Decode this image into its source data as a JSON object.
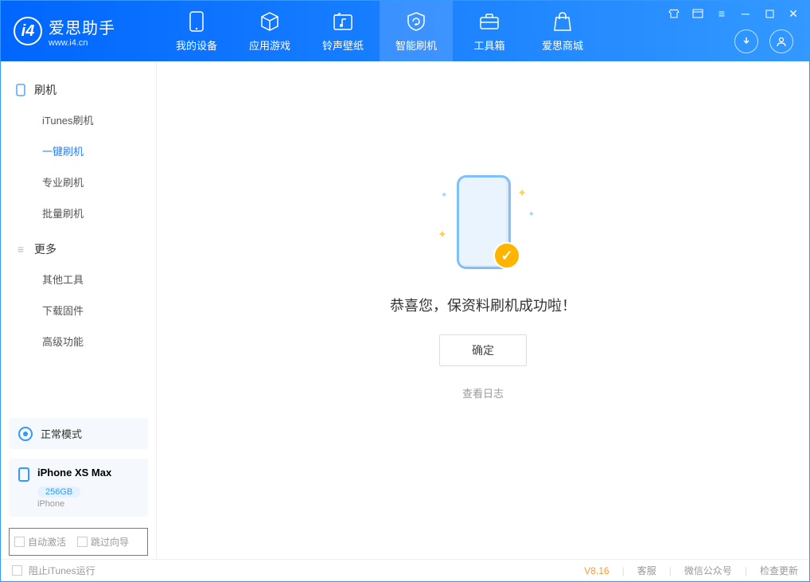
{
  "brand": {
    "name": "爱思助手",
    "url": "www.i4.cn"
  },
  "nav": {
    "device": "我的设备",
    "apps": "应用游戏",
    "ringtone": "铃声壁纸",
    "flash": "智能刷机",
    "toolbox": "工具箱",
    "store": "爱思商城"
  },
  "sidebar": {
    "section1": {
      "title": "刷机",
      "items": [
        "iTunes刷机",
        "一键刷机",
        "专业刷机",
        "批量刷机"
      ]
    },
    "section2": {
      "title": "更多",
      "items": [
        "其他工具",
        "下载固件",
        "高级功能"
      ]
    }
  },
  "device_status": {
    "mode": "正常模式"
  },
  "device_info": {
    "name": "iPhone XS Max",
    "storage": "256GB",
    "type": "iPhone"
  },
  "checkboxes": {
    "auto_activate": "自动激活",
    "skip_guide": "跳过向导"
  },
  "main": {
    "success_text": "恭喜您，保资料刷机成功啦！",
    "ok_button": "确定",
    "view_log": "查看日志"
  },
  "statusbar": {
    "block_itunes": "阻止iTunes运行",
    "version": "V8.16",
    "support": "客服",
    "wechat": "微信公众号",
    "update": "检查更新"
  }
}
